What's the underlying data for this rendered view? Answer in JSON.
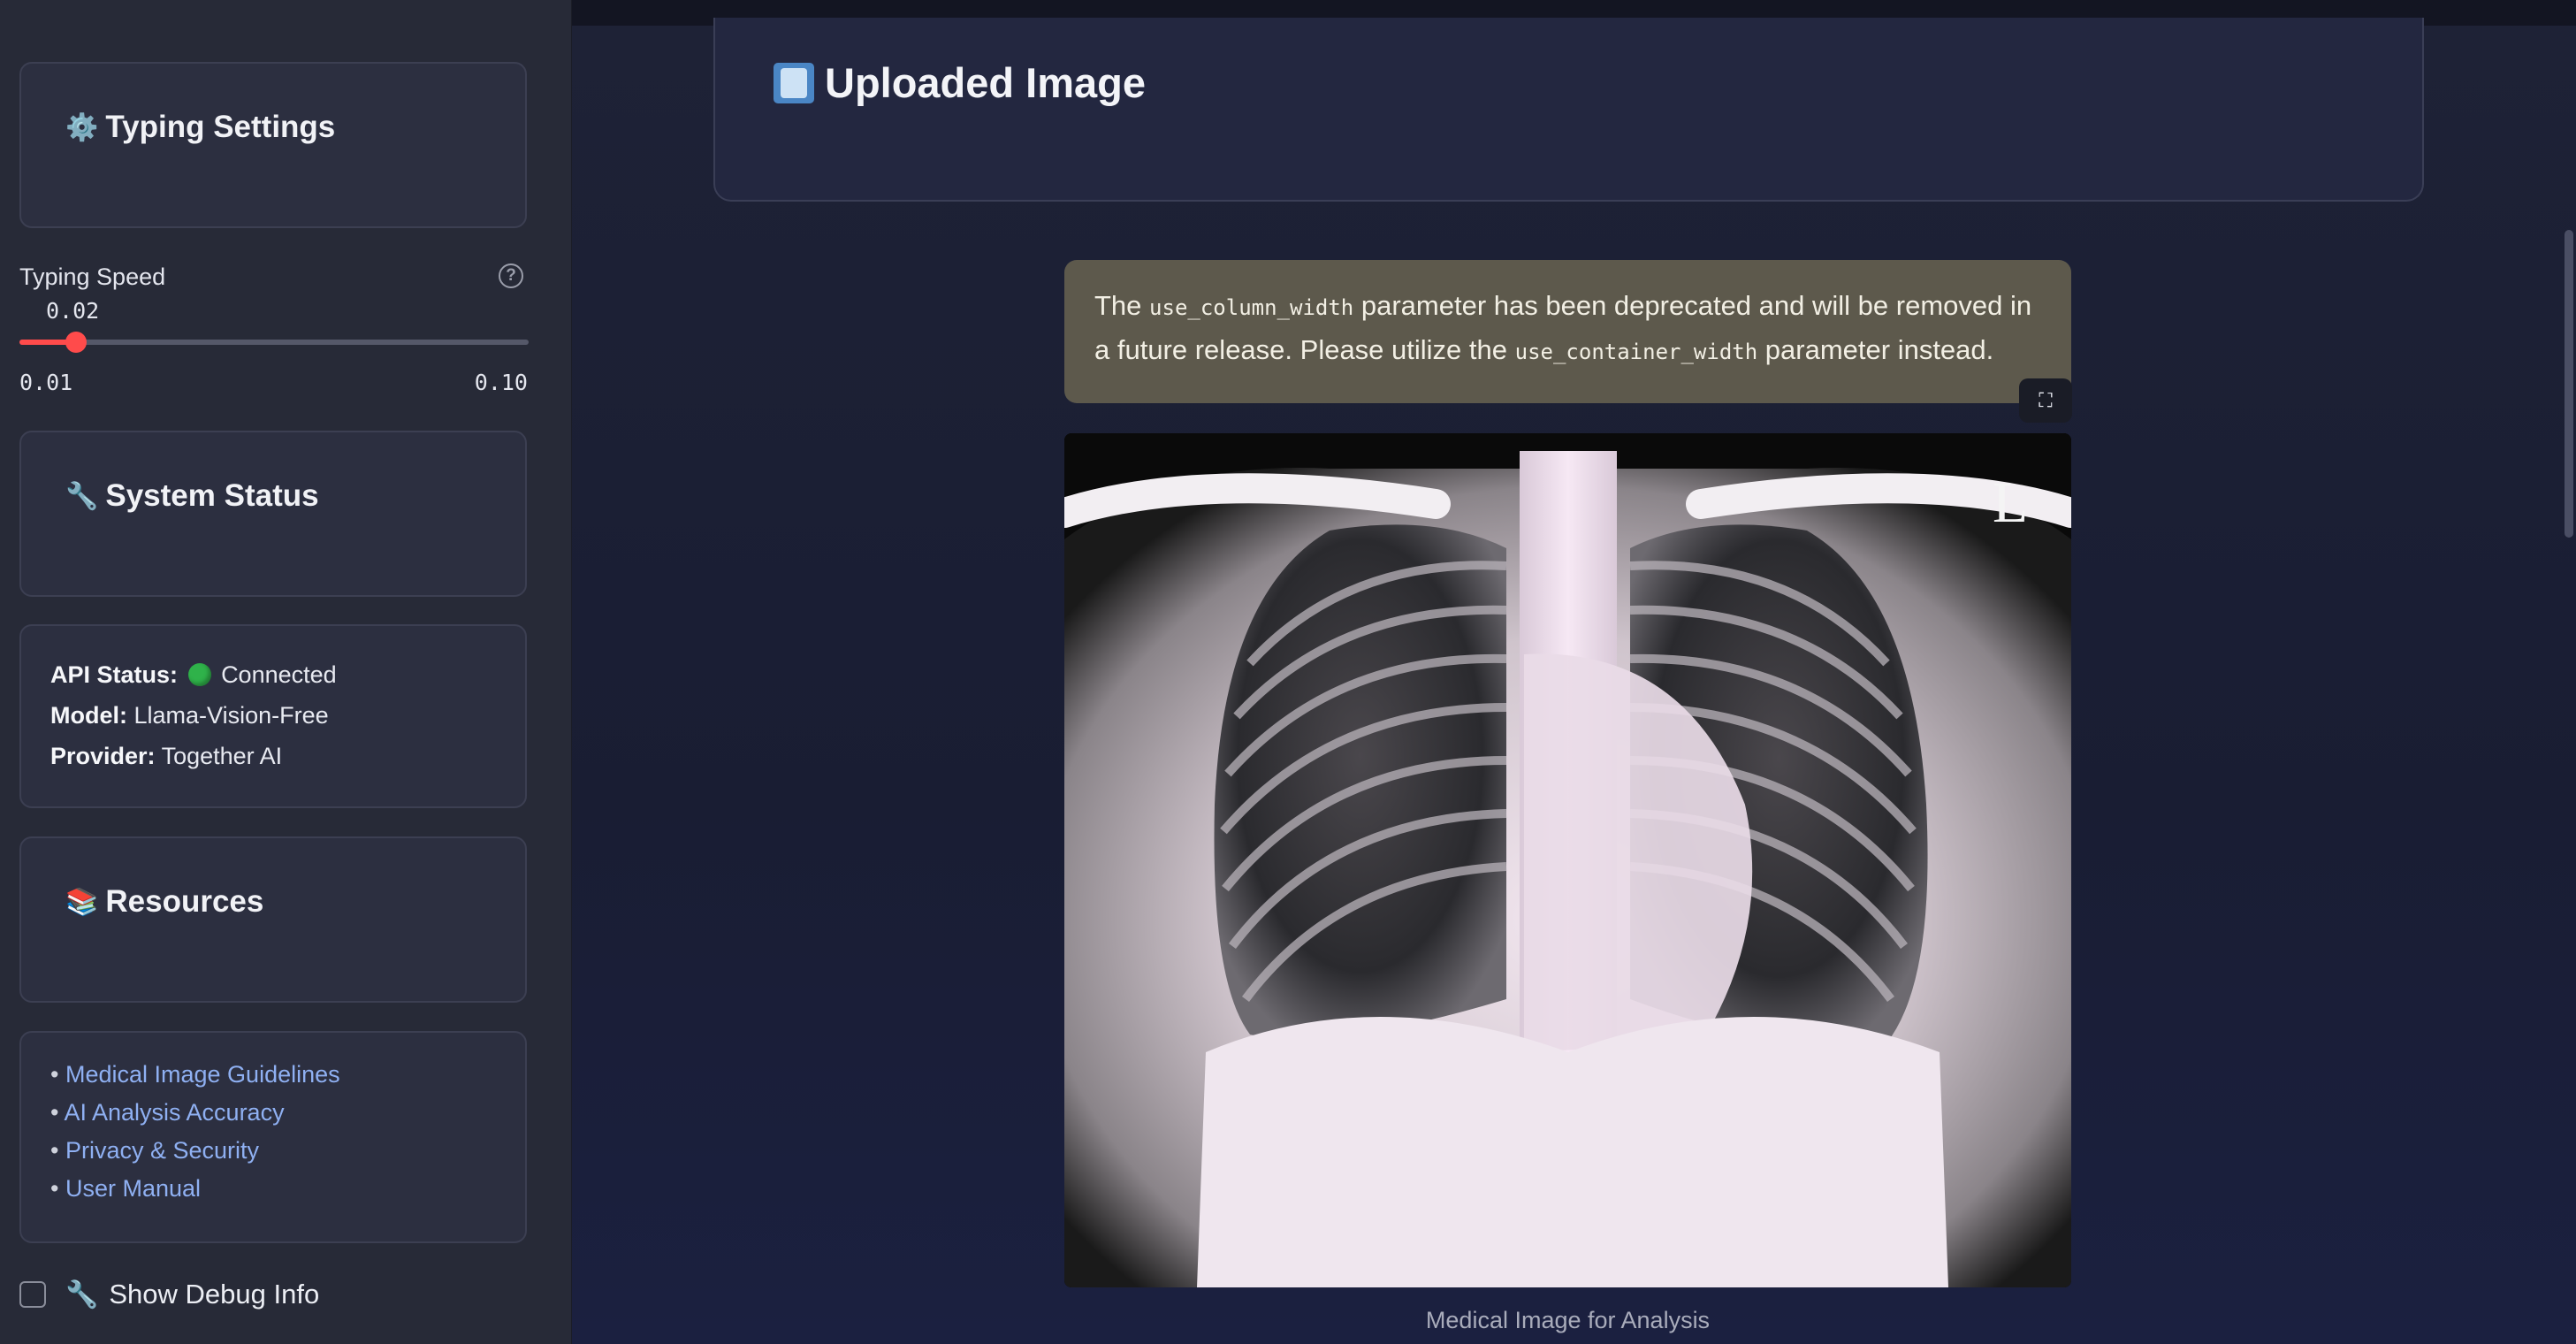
{
  "sidebar": {
    "typing_settings": {
      "icon": "gear-icon",
      "emoji": "⚙️",
      "title": "Typing Settings"
    },
    "typing_speed": {
      "label": "Typing Speed",
      "value": "0.02",
      "min_label": "0.01",
      "max_label": "0.10",
      "min": 0.01,
      "max": 0.1,
      "current": 0.02
    },
    "system_status": {
      "icon": "wrench-icon",
      "emoji": "🔧",
      "title": "System Status"
    },
    "status_info": {
      "api_label": "API Status:",
      "api_value": "Connected",
      "api_color": "#2fb24a",
      "model_label": "Model:",
      "model_value": "Llama-Vision-Free",
      "provider_label": "Provider:",
      "provider_value": "Together AI"
    },
    "resources": {
      "icon": "books-icon",
      "emoji": "📚",
      "title": "Resources"
    },
    "links": [
      {
        "bullet": "•",
        "label": "Medical Image Guidelines"
      },
      {
        "bullet": "•",
        "label": "AI Analysis Accuracy"
      },
      {
        "bullet": "•",
        "label": "Privacy & Security"
      },
      {
        "bullet": "•",
        "label": "User Manual"
      }
    ],
    "debug": {
      "emoji": "🔧",
      "label": "Show Debug Info",
      "checked": false
    }
  },
  "main": {
    "upload_title": "Uploaded Image",
    "warning": {
      "pre": "The",
      "code1": "use_column_width",
      "mid": "parameter has been deprecated and will be removed in a future release. Please utilize the",
      "code2": "use_container_width",
      "post": "parameter instead."
    },
    "expand_icon": "fullscreen-icon",
    "image_marker": "L",
    "caption": "Medical Image for Analysis"
  },
  "colors": {
    "accent": "#ff4b4b",
    "link": "#8fb0f2",
    "warning_bg": "#5d594c"
  }
}
